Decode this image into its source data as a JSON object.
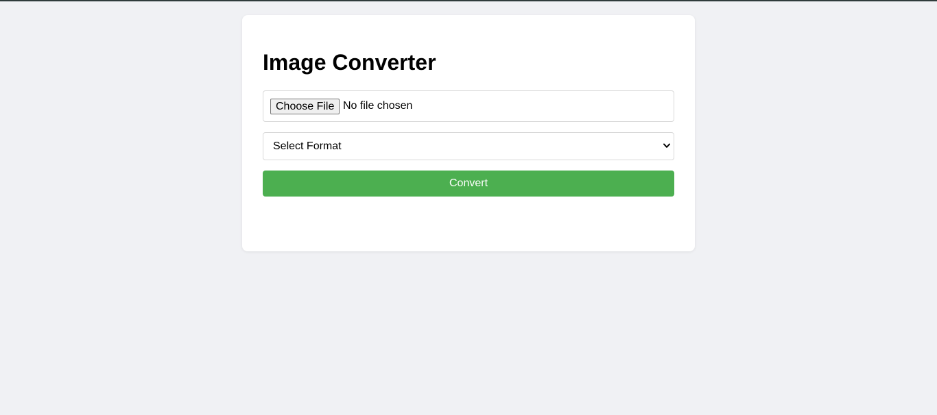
{
  "app": {
    "title": "Image Converter"
  },
  "file_input": {
    "button_label": "Choose File",
    "status_text": "No file chosen"
  },
  "format_select": {
    "selected_value": "Select Format"
  },
  "convert_button": {
    "label": "Convert"
  },
  "colors": {
    "page_background": "#f0f1f4",
    "card_background": "#ffffff",
    "primary_button": "#4caf50",
    "primary_button_text": "#ffffff",
    "border": "#d8d8d8"
  },
  "icons": {
    "select_arrow": "chevron-down-icon"
  }
}
